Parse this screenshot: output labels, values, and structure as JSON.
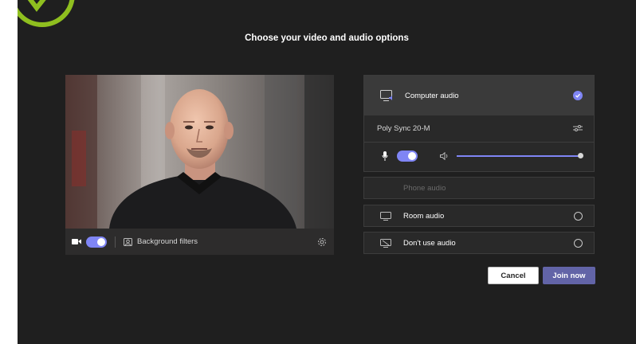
{
  "title": "Choose your video and audio options",
  "video": {
    "background_filters_label": "Background filters",
    "camera_on": true
  },
  "audio": {
    "computer_audio_label": "Computer audio",
    "device_name": "Poly Sync 20-M",
    "mic_on": true,
    "volume_level": 1.0,
    "phone_audio_label": "Phone audio",
    "room_audio_label": "Room audio",
    "dont_use_audio_label": "Don't use audio"
  },
  "buttons": {
    "cancel_label": "Cancel",
    "join_label": "Join now"
  },
  "colors": {
    "background": "#1f1f1f",
    "accent": "#7f85f5",
    "join_button": "#6264a7",
    "logo": "#8fbf1f"
  }
}
